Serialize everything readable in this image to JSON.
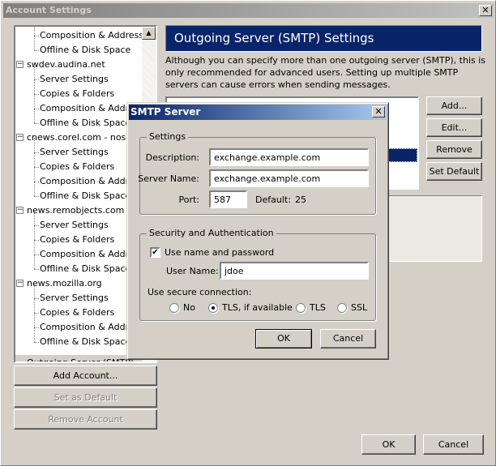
{
  "window": {
    "title": "Account Settings"
  },
  "tree": {
    "items": [
      {
        "label": "Composition & Addressing",
        "level": 1
      },
      {
        "label": "Offline & Disk Space",
        "level": 1
      },
      {
        "label": "swdev.audina.net",
        "level": 0
      },
      {
        "label": "Server Settings",
        "level": 1
      },
      {
        "label": "Copies & Folders",
        "level": 1
      },
      {
        "label": "Composition & Addressing",
        "level": 1
      },
      {
        "label": "Offline & Disk Space",
        "level": 1
      },
      {
        "label": "cnews.corel.com - nospam",
        "level": 0
      },
      {
        "label": "Server Settings",
        "level": 1
      },
      {
        "label": "Copies & Folders",
        "level": 1
      },
      {
        "label": "Composition & Addressing",
        "level": 1
      },
      {
        "label": "Offline & Disk Space",
        "level": 1
      },
      {
        "label": "news.remobjects.com",
        "level": 0
      },
      {
        "label": "Server Settings",
        "level": 1
      },
      {
        "label": "Copies & Folders",
        "level": 1
      },
      {
        "label": "Composition & Addressing",
        "level": 1
      },
      {
        "label": "Offline & Disk Space",
        "level": 1
      },
      {
        "label": "news.mozilla.org",
        "level": 0
      },
      {
        "label": "Server Settings",
        "level": 1
      },
      {
        "label": "Copies & Folders",
        "level": 1
      },
      {
        "label": "Composition & Addressing",
        "level": 1
      },
      {
        "label": "Offline & Disk Space",
        "level": 1
      }
    ],
    "selected": "Outgoing Server (SMTP)"
  },
  "left_buttons": {
    "add_account": "Add Account...",
    "set_default": "Set as Default",
    "remove_account": "Remove Account"
  },
  "main": {
    "header": "Outgoing Server (SMTP) Settings",
    "description": "Although you can specify more than one outgoing server (SMTP), this is only recommended for advanced users. Setting up multiple SMTP servers can cause errors when sending messages.",
    "buttons": {
      "add": "Add...",
      "edit": "Edit...",
      "remove": "Remove",
      "set_default": "Set Default"
    }
  },
  "footer": {
    "ok": "OK",
    "cancel": "Cancel"
  },
  "dialog": {
    "title": "SMTP Server",
    "settings_legend": "Settings",
    "description_label": "Description:",
    "description_value": "exchange.example.com",
    "server_label": "Server Name:",
    "server_value": "exchange.example.com",
    "port_label": "Port:",
    "port_value": "587",
    "default_label": "Default:",
    "default_value": "25",
    "security_legend": "Security and Authentication",
    "use_name_label": "Use name and password",
    "use_name_checked": true,
    "username_label": "User Name:",
    "username_value": "jdoe",
    "secure_label": "Use secure connection:",
    "radios": [
      {
        "label": "No",
        "checked": false
      },
      {
        "label": "TLS, if available",
        "checked": true
      },
      {
        "label": "TLS",
        "checked": false
      },
      {
        "label": "SSL",
        "checked": false
      }
    ],
    "ok": "OK",
    "cancel": "Cancel"
  },
  "colors": {
    "header_bg": "#0a246a",
    "dialog_title_start": "#0a246a",
    "dialog_title_end": "#a6caf0"
  }
}
